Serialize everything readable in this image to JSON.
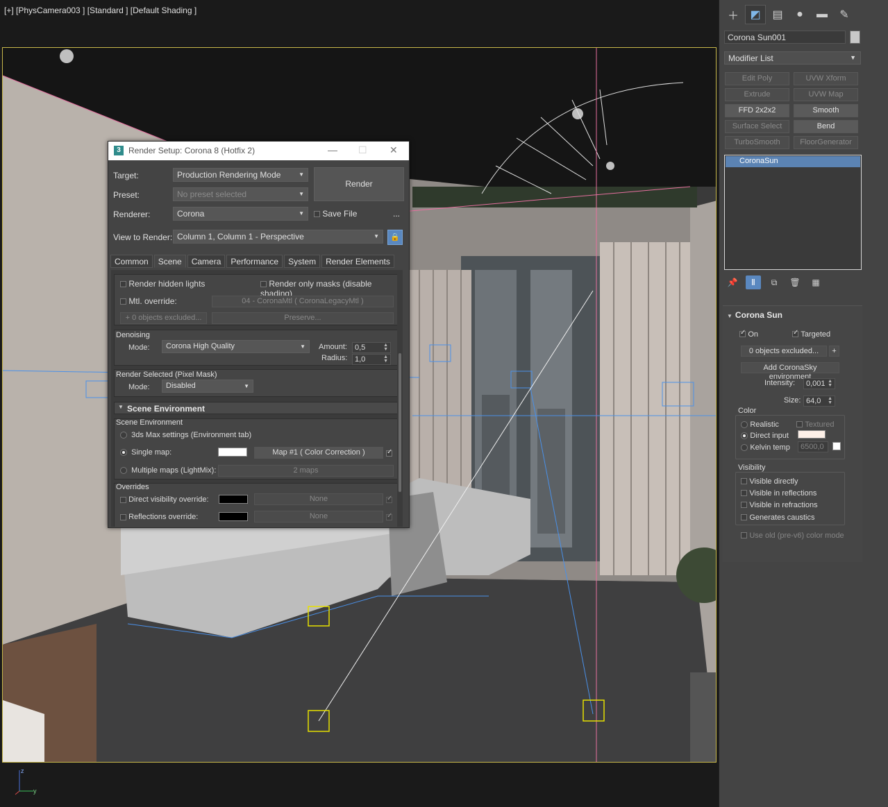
{
  "viewport": {
    "label": "[+] [PhysCamera003 ] [Standard ] [Default Shading ]"
  },
  "command_panel": {
    "tabs": [
      "create-icon",
      "modify-icon",
      "hierarchy-icon",
      "motion-icon",
      "display-icon",
      "utilities-icon"
    ],
    "object_name": "Corona Sun001",
    "modifier_list": "Modifier List",
    "modifier_buttons": [
      {
        "label": "Edit Poly",
        "enabled": false
      },
      {
        "label": "UVW Xform",
        "enabled": false
      },
      {
        "label": "Extrude",
        "enabled": false
      },
      {
        "label": "UVW Map",
        "enabled": false
      },
      {
        "label": "FFD 2x2x2",
        "enabled": true
      },
      {
        "label": "Smooth",
        "enabled": true
      },
      {
        "label": "Surface Select",
        "enabled": false
      },
      {
        "label": "Bend",
        "enabled": true
      },
      {
        "label": "TurboSmooth",
        "enabled": false
      },
      {
        "label": "FloorGenerator",
        "enabled": false
      }
    ],
    "stack_item": "CoronaSun",
    "rollout": {
      "title": "Corona Sun",
      "on_label": "On",
      "targeted_label": "Targeted",
      "excluded_btn": "0 objects excluded...",
      "plus_btn": "+",
      "add_sky_btn": "Add CoronaSky environment",
      "intensity_label": "Intensity:",
      "intensity_value": "0,001",
      "size_label": "Size:",
      "size_value": "64,0",
      "color_group": "Color",
      "realistic_label": "Realistic",
      "textured_label": "Textured",
      "direct_input_label": "Direct input",
      "kelvin_label": "Kelvin temp",
      "kelvin_value": "6500,0",
      "visibility_group": "Visibility",
      "visible_directly": "Visible directly",
      "visible_reflections": "Visible in reflections",
      "visible_refractions": "Visible in refractions",
      "generates_caustics": "Generates caustics",
      "old_color_mode": "Use old (pre-v6) color mode"
    }
  },
  "dialog": {
    "app_icon": "3",
    "title": "Render Setup: Corona 8 (Hotfix 2)",
    "target_label": "Target:",
    "target_value": "Production Rendering Mode",
    "preset_label": "Preset:",
    "preset_value": "No preset selected",
    "renderer_label": "Renderer:",
    "renderer_value": "Corona",
    "save_file_label": "Save File",
    "ellipsis": "...",
    "render_btn": "Render",
    "view_label": "View to Render:",
    "view_value": "Column 1, Column 1 - Perspective",
    "tabs": [
      "Common",
      "Scene",
      "Camera",
      "Performance",
      "System",
      "Render Elements"
    ],
    "active_tab": "Scene",
    "render_hidden_lights": "Render hidden lights",
    "render_only_masks": "Render only masks (disable shading)",
    "mtl_override": "Mtl. override:",
    "mtl_override_value": "04 - CoronaMtl  ( CoronaLegacyMtl )",
    "objects_excluded": "0 objects excluded...",
    "preserve": "Preserve...",
    "denoising_header": "Denoising",
    "mode_label": "Mode:",
    "denoise_mode": "Corona High Quality",
    "amount_label": "Amount:",
    "amount_value": "0,5",
    "radius_label": "Radius:",
    "radius_value": "1,0",
    "render_selected_header": "Render Selected (Pixel Mask)",
    "render_selected_mode": "Disabled",
    "scene_env_rollout": "Scene Environment",
    "scene_env_group": "Scene Environment",
    "env_3ds": "3ds Max settings (Environment tab)",
    "env_single": "Single map:",
    "env_single_map": "Map #1  ( Color Correction )",
    "env_multiple": "Multiple maps (LightMix):",
    "env_multiple_map": "2 maps",
    "overrides_group": "Overrides",
    "direct_vis_override": "Direct visibility override:",
    "reflections_override": "Reflections override:",
    "none_label": "None"
  },
  "colors": {
    "selection_blue": "#5b83b3",
    "viewport_border": "#c8b84a",
    "corona_teal": "#2f8c8c"
  }
}
